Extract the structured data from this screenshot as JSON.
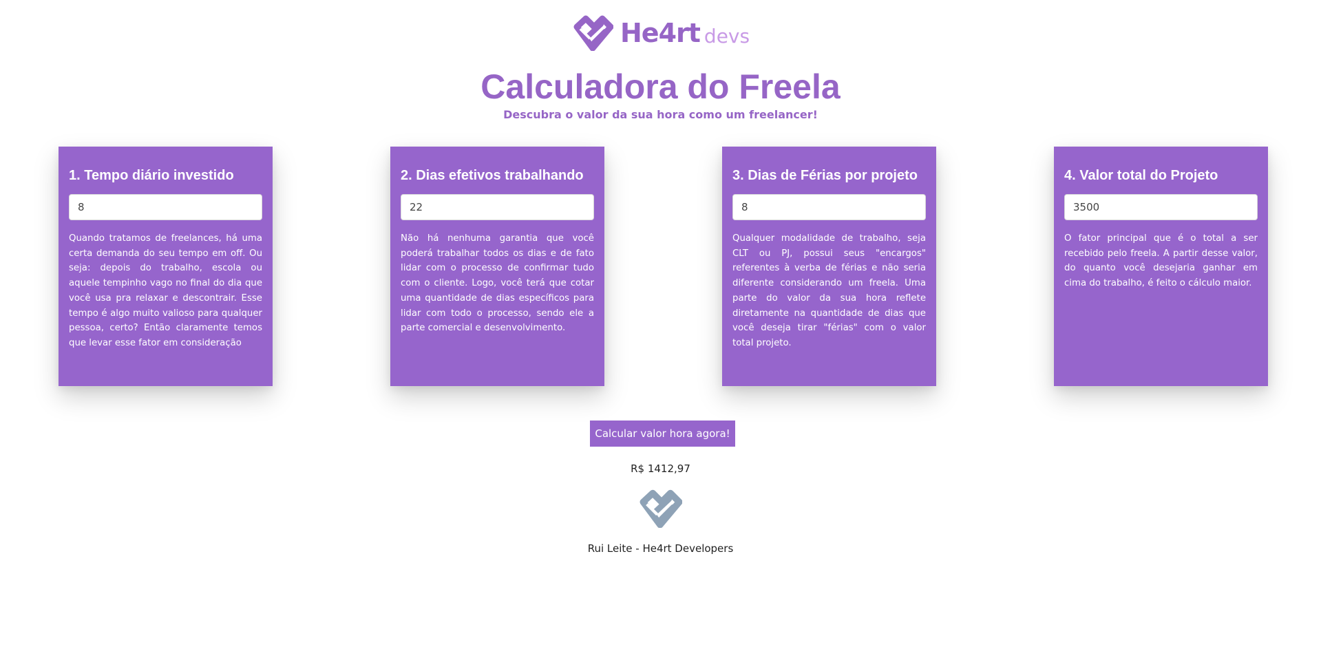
{
  "header": {
    "logo_main": "He4rt",
    "logo_sub": "devs",
    "title": "Calculadora do Freela",
    "subtitle": "Descubra o valor da sua hora como um freelancer!"
  },
  "cards": [
    {
      "heading": "1. Tempo diário investido",
      "input_value": "8",
      "description": "Quando tratamos de freelances, há uma certa demanda do seu tempo em off. Ou seja: depois do trabalho, escola ou aquele tempinho vago no final do dia que você usa pra relaxar e descontrair. Esse tempo é algo muito valioso para qualquer pessoa, certo? Então claramente temos que levar esse fator em consideração"
    },
    {
      "heading": "2. Dias efetivos trabalhando",
      "input_value": "22",
      "description": "Não há nenhuma garantia que você poderá trabalhar todos os dias e de fato lidar com o processo de confirmar tudo com o cliente. Logo, você terá que cotar uma quantidade de dias específicos para lidar com todo o processo, sendo ele a parte comercial e desenvolvimento."
    },
    {
      "heading": "3. Dias de Férias por projeto",
      "input_value": "8",
      "description": "Qualquer modalidade de trabalho, seja CLT ou PJ, possui seus \"encargos\" referentes à verba de férias e não seria diferente considerando um freela. Uma parte do valor da sua hora reflete diretamente na quantidade de dias que você deseja tirar \"férias\" com o valor total projeto."
    },
    {
      "heading": "4. Valor total do Projeto",
      "input_value": "3500",
      "description": "O fator principal que é o total a ser recebido pelo freela. A partir desse valor, do quanto você desejaria ganhar em cima do trabalho, é feito o cálculo maior."
    }
  ],
  "calculate_button_label": "Calcular valor hora agora!",
  "result": "R$ 1412,97",
  "footer": {
    "credit": "Rui Leite - He4rt Developers"
  },
  "colors": {
    "accent": "#9665cc",
    "logo_light": "#c89ae6",
    "footer_logo": "#8ea2b6"
  },
  "icons": {
    "header_logo": "heart-code-icon",
    "footer_logo": "heart-code-icon"
  }
}
